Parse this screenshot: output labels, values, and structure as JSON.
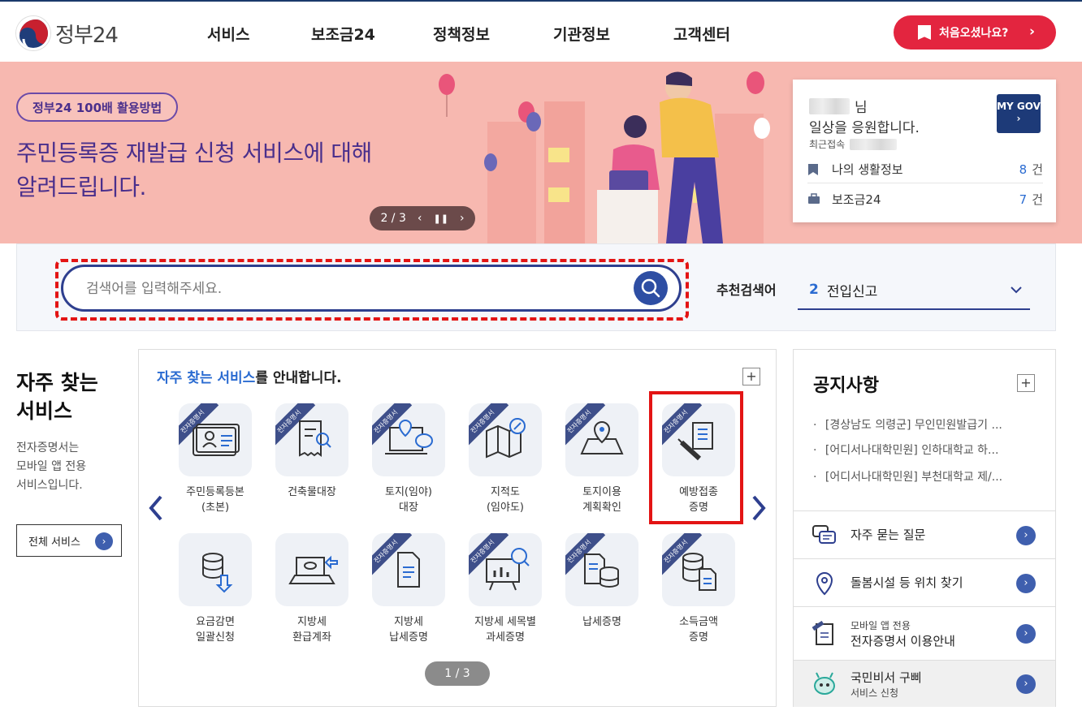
{
  "header": {
    "logo_text": "정부24",
    "nav": [
      "서비스",
      "보조금24",
      "정책정보",
      "기관정보",
      "고객센터"
    ],
    "first_visit_label": "처음오셨나요?"
  },
  "banner": {
    "badge": "정부24 100배 활용방법",
    "title": "주민등록증 재발급 신청 서비스에 대해 알려드립니다.",
    "pager": "2 / 3"
  },
  "mygov": {
    "suffix": "님",
    "greeting": "일상을 응원합니다.",
    "last_access_label": "최근접속",
    "button": "MY GOV",
    "items": [
      {
        "label": "나의 생활정보",
        "count": "8",
        "unit": "건"
      },
      {
        "label": "보조금24",
        "count": "7",
        "unit": "건"
      }
    ]
  },
  "search": {
    "placeholder": "검색어를 입력해주세요.",
    "recommend_label": "추천검색어",
    "recommend_num": "2",
    "recommend_term": "전입신고"
  },
  "frequent": {
    "title_line1": "자주 찾는",
    "title_line2": "서비스",
    "desc": [
      "전자증명서는",
      "모바일 앱 전용",
      "서비스입니다."
    ],
    "all_button": "전체 서비스",
    "heading_hl": "자주 찾는 서비스",
    "heading_rest": "를 안내합니다.",
    "ribbon": "전자증명서",
    "services": [
      {
        "line1": "주민등록등본",
        "line2": "(초본)"
      },
      {
        "line1": "건축물대장",
        "line2": ""
      },
      {
        "line1": "토지(임야)",
        "line2": "대장"
      },
      {
        "line1": "지적도",
        "line2": "(임야도)"
      },
      {
        "line1": "토지이용",
        "line2": "계획확인"
      },
      {
        "line1": "예방접종",
        "line2": "증명"
      },
      {
        "line1": "요금감면",
        "line2": "일괄신청"
      },
      {
        "line1": "지방세",
        "line2": "환급계좌"
      },
      {
        "line1": "지방세",
        "line2": "납세증명"
      },
      {
        "line1": "지방세 세목별",
        "line2": "과세증명"
      },
      {
        "line1": "납세증명",
        "line2": ""
      },
      {
        "line1": "소득금액",
        "line2": "증명"
      }
    ],
    "pager": "1 / 3"
  },
  "notices": {
    "title": "공지사항",
    "items": [
      "[경상남도 의령군] 무인민원발급기 ...",
      "[어디서나대학민원] 인하대학교 하...",
      "[어디서나대학민원] 부천대학교 제/..."
    ],
    "quick": [
      {
        "label": "자주 묻는 질문",
        "sub": ""
      },
      {
        "label": "돌봄시설 등 위치 찾기",
        "sub": ""
      },
      {
        "label": "전자증명서 이용안내",
        "sub": "모바일 앱 전용"
      },
      {
        "label": "국민비서 구삐",
        "sub": "서비스 신청"
      }
    ]
  },
  "colors": {
    "brand_red": "#e3253f",
    "navy": "#2e3f8f",
    "banner_bg": "#f7b8b0",
    "link_blue": "#2a6bd1"
  }
}
